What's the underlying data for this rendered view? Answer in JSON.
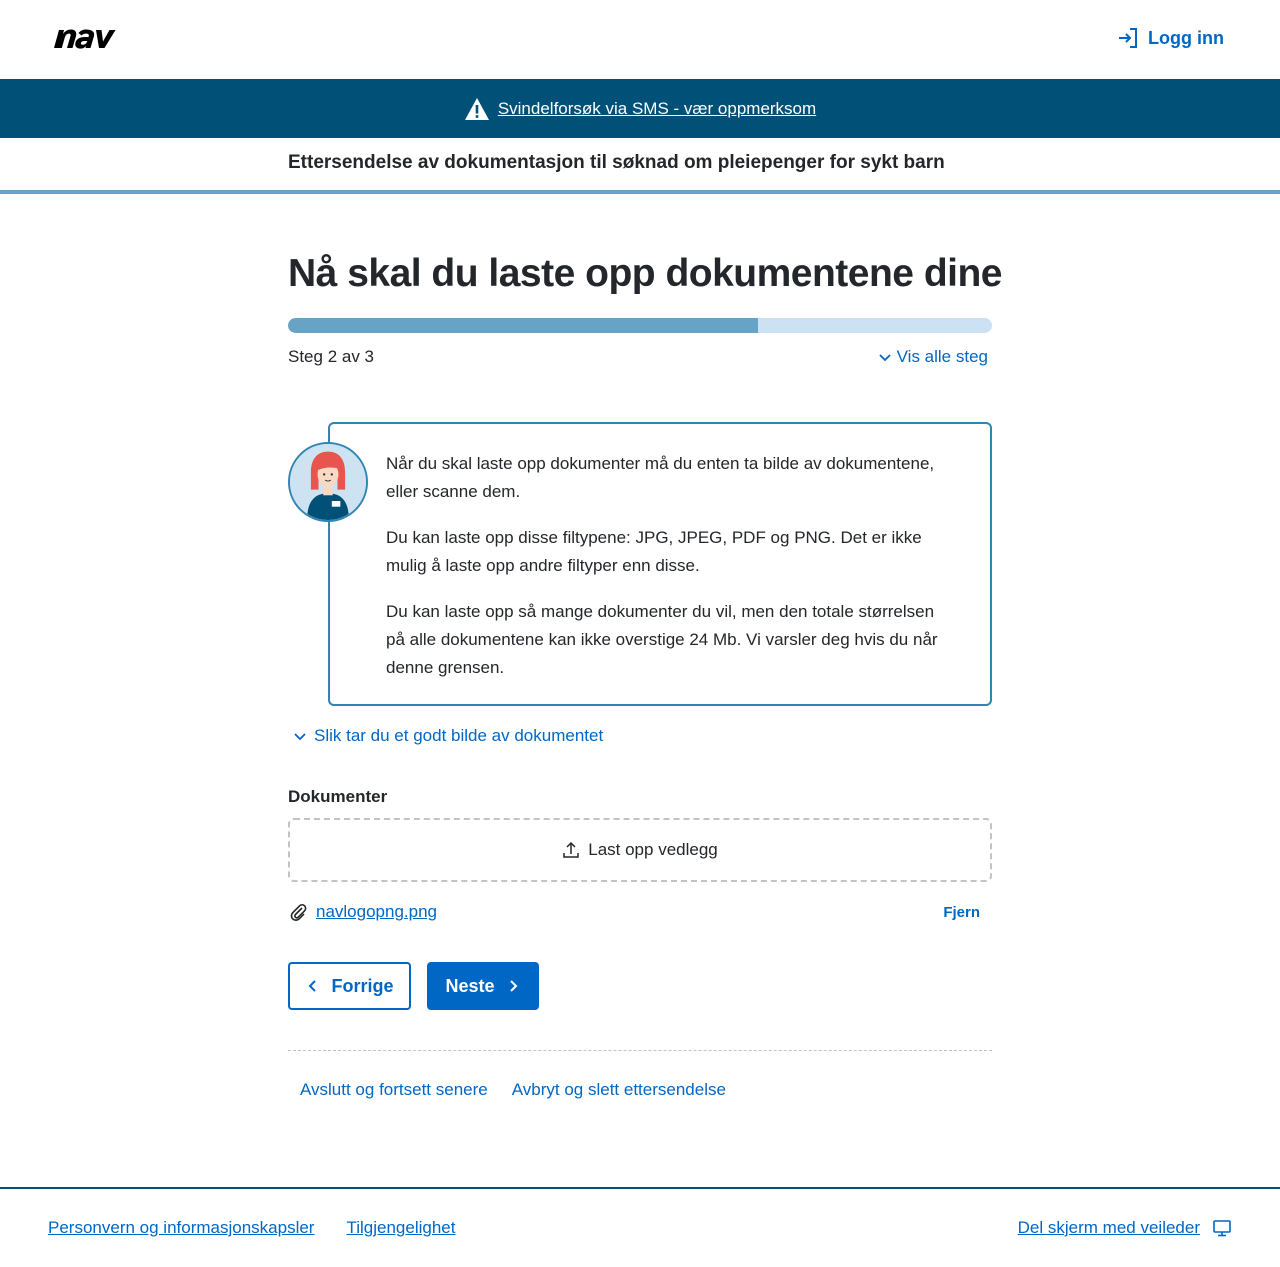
{
  "header": {
    "logo_text": "nav",
    "login_label": "Logg inn"
  },
  "banner": {
    "text": "Svindelforsøk via SMS - vær oppmerksom"
  },
  "subheader": {
    "title": "Ettersendelse av dokumentasjon til søknad om pleiepenger for sykt barn"
  },
  "main": {
    "title": "Nå skal du laste opp dokumentene dine",
    "progress": {
      "current": 2,
      "total": 3,
      "fraction": 0.667
    },
    "step_text": "Steg 2 av 3",
    "show_all_steps": "Vis alle steg",
    "guide": {
      "paragraphs": [
        "Når du skal laste opp dokumenter må du enten ta bilde av dokumentene, eller scanne dem.",
        "Du kan laste opp disse filtypene: JPG, JPEG, PDF og PNG. Det er ikke mulig å laste opp andre filtyper enn disse.",
        "Du kan laste opp så mange dokumenter du vil, men den totale størrelsen på alle dokumentene kan ikke overstige 24 Mb. Vi varsler deg hvis du når denne grensen."
      ]
    },
    "readmore_label": "Slik tar du et godt bilde av dokumentet",
    "documents_label": "Dokumenter",
    "upload_label": "Last opp vedlegg",
    "file": {
      "name": "navlogopng.png",
      "remove_label": "Fjern"
    },
    "prev_label": "Forrige",
    "next_label": "Neste",
    "links": {
      "save_continue": "Avslutt og fortsett senere",
      "cancel_delete": "Avbryt og slett ettersendelse"
    }
  },
  "footer": {
    "privacy": "Personvern og informasjonskapsler",
    "accessibility": "Tilgjengelighet",
    "share_screen": "Del skjerm med veileder"
  },
  "colors": {
    "primary": "#0067c5",
    "banner_bg": "#005077",
    "progress_fill": "#66a3c4",
    "progress_track": "#cce1f3",
    "guide_border": "#3385b1"
  }
}
